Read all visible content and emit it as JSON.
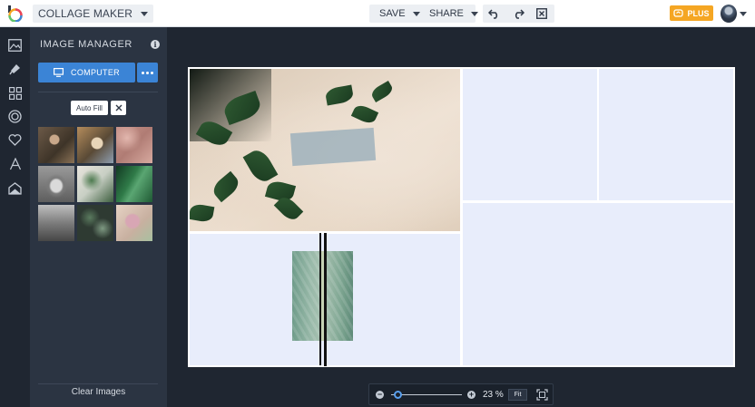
{
  "header": {
    "app_title": "COLLAGE MAKER",
    "save_label": "SAVE",
    "share_label": "SHARE",
    "plus_label": "PLUS",
    "icons": [
      "undo-icon",
      "redo-icon",
      "close-icon"
    ]
  },
  "rail": {
    "icons": [
      "image-icon",
      "brush-icon",
      "layout-icon",
      "shape-icon",
      "heart-icon",
      "text-icon",
      "overlay-icon"
    ]
  },
  "panel": {
    "title": "IMAGE MANAGER",
    "computer_label": "COMPUTER",
    "autofill_label": "Auto Fill",
    "clear_label": "Clear Images",
    "thumbnail_count": 9
  },
  "zoom": {
    "value": "23 %",
    "fit_label": "Fit",
    "level": 0.1
  },
  "colors": {
    "accent": "#3b84d6",
    "plus": "#f5a623",
    "empty_cell": "#e8edfb",
    "panel": "#2b3442",
    "background": "#1f2631"
  }
}
